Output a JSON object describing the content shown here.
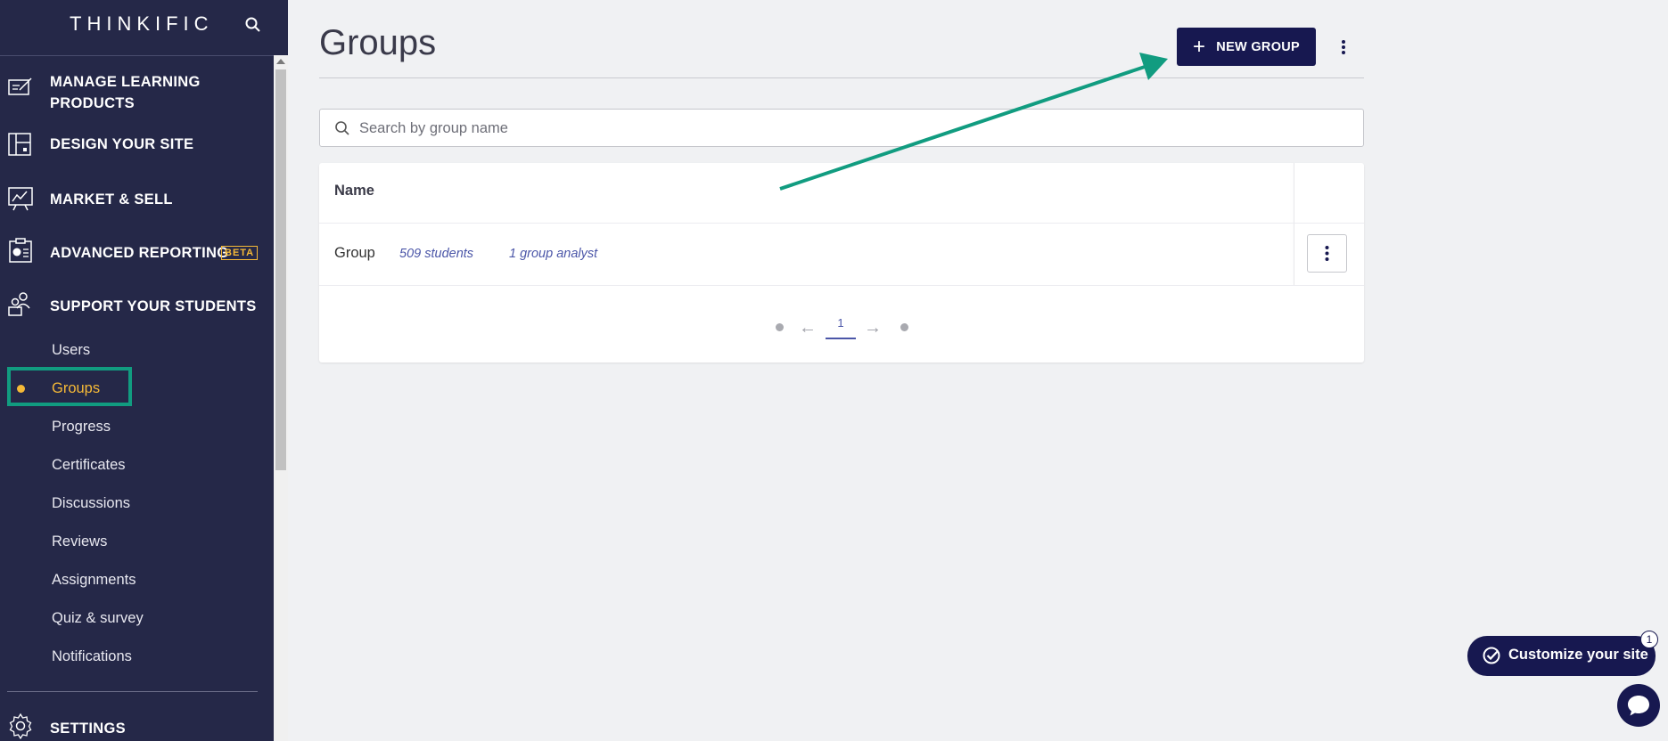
{
  "sidebar": {
    "logo": "THINKIFIC",
    "sections": [
      {
        "label": "MANAGE LEARNING",
        "label2": "PRODUCTS",
        "icon": "edit-document-icon"
      },
      {
        "label": "DESIGN YOUR SITE",
        "icon": "layout-icon"
      },
      {
        "label": "MARKET & SELL",
        "icon": "chart-board-icon"
      },
      {
        "label": "ADVANCED REPORTING",
        "badge": "BETA",
        "icon": "report-icon"
      },
      {
        "label": "SUPPORT YOUR STUDENTS",
        "icon": "users-icon"
      },
      {
        "label": "SETTINGS",
        "icon": "gear-icon"
      }
    ],
    "subitems": [
      "Users",
      "Groups",
      "Progress",
      "Certificates",
      "Discussions",
      "Reviews",
      "Assignments",
      "Quiz & survey",
      "Notifications"
    ],
    "active_subitem": "Groups"
  },
  "page": {
    "title": "Groups",
    "new_button": "NEW GROUP",
    "search_placeholder": "Search by group name"
  },
  "table": {
    "column_name": "Name",
    "rows": [
      {
        "name": "Group",
        "students": "509 students",
        "analysts": "1 group analyst"
      }
    ]
  },
  "pagination": {
    "current": "1"
  },
  "widgets": {
    "customize_label": "Customize your site",
    "customize_badge": "1"
  },
  "colors": {
    "sidebar_bg": "#252848",
    "accent": "#f5b937",
    "primary_button": "#171850",
    "annotation": "#119c80"
  }
}
